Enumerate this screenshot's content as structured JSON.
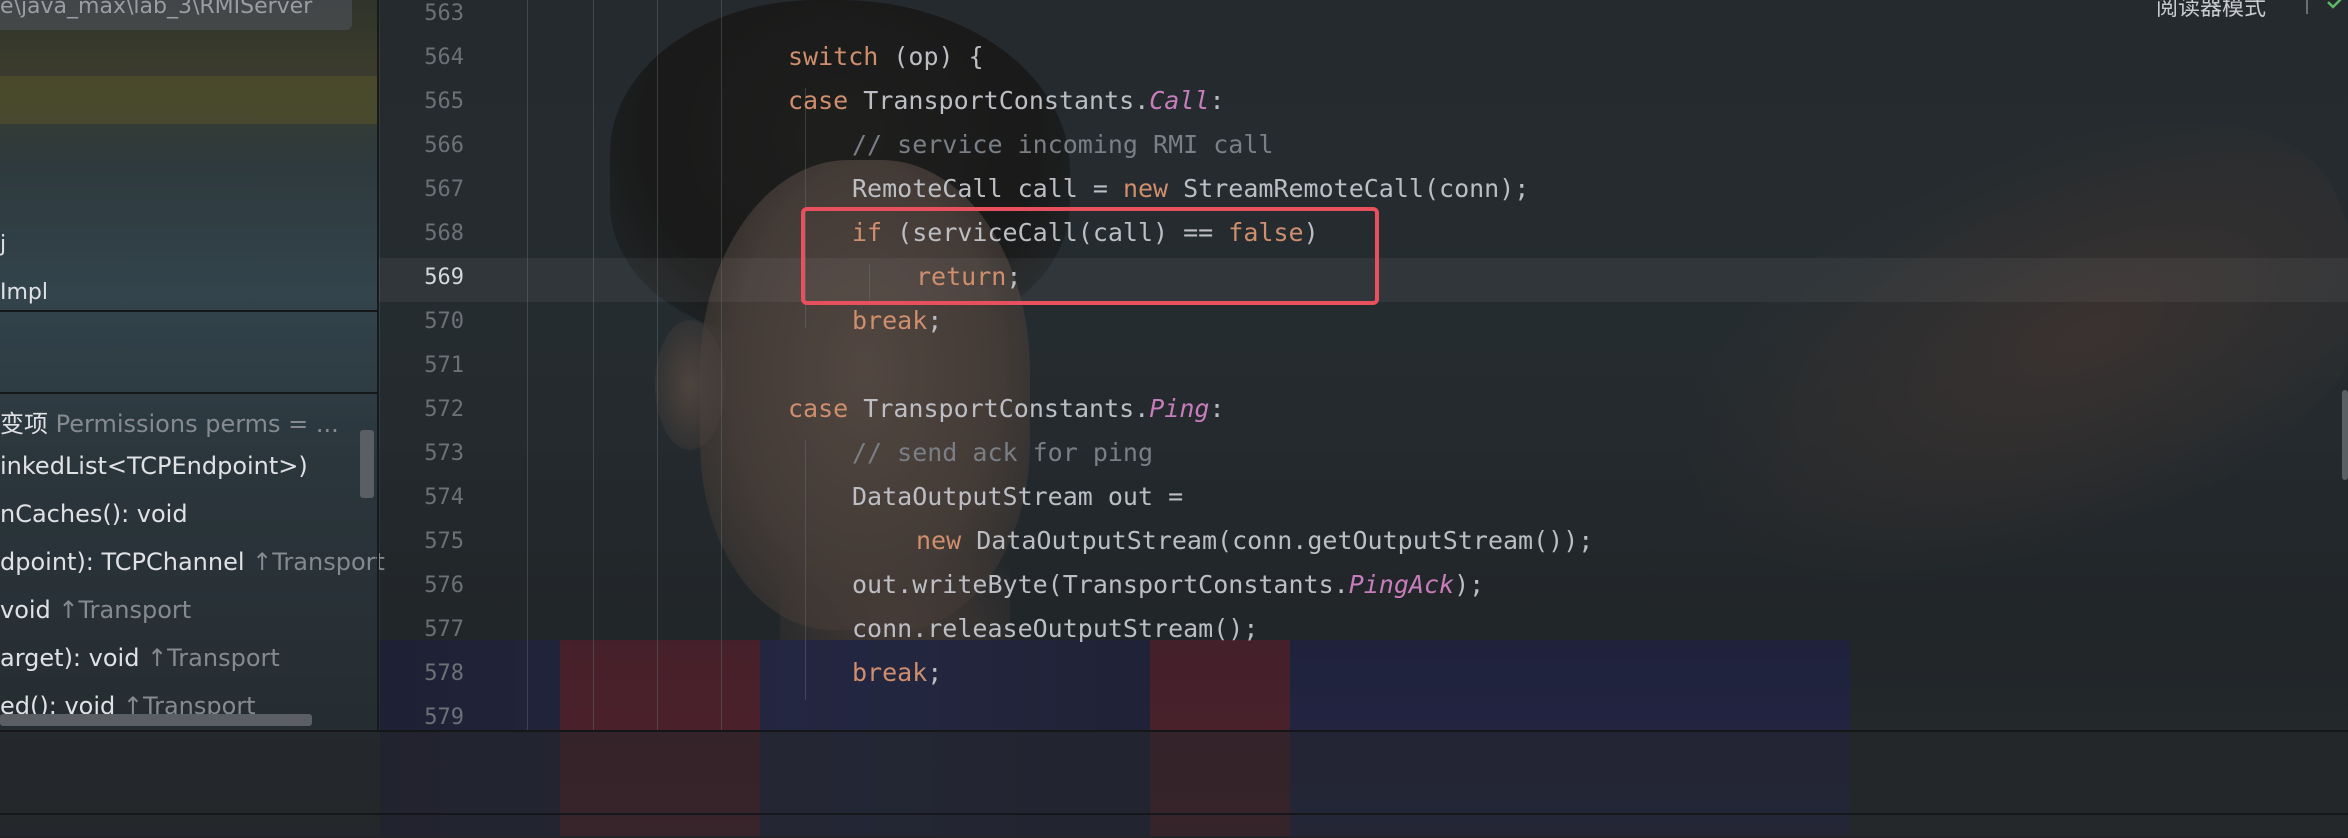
{
  "left_panel": {
    "path": "e\\java_max\\lab_3\\RMIServer",
    "project_items": [
      "j",
      "Impl"
    ],
    "structure_items": [
      {
        "main": "变项",
        "gray": " Permissions perms = ..."
      },
      {
        "main": "inkedList<TCPEndpoint>)",
        "gray": ""
      },
      {
        "main": "nCaches(): void",
        "gray": ""
      },
      {
        "main": "dpoint): TCPChannel",
        "gray": " ↑Transport"
      },
      {
        "main": "void",
        "gray": " ↑Transport"
      },
      {
        "main": "arget): void",
        "gray": " ↑Transport"
      },
      {
        "main": "ed(): void",
        "gray": " ↑Transport"
      }
    ]
  },
  "editor": {
    "reader_mode": "阅读器模式",
    "current_line": 569,
    "line_numbers": [
      563,
      564,
      565,
      566,
      567,
      568,
      569,
      570,
      571,
      572,
      573,
      574,
      575,
      576,
      577,
      578,
      579
    ],
    "code": {
      "l564": {
        "a": "switch",
        "b": " (op) {"
      },
      "l565": {
        "a": "case",
        "b": " TransportConstants.",
        "c": "Call",
        "d": ":"
      },
      "l566": {
        "a": "// service incoming RMI call"
      },
      "l567": {
        "a": "RemoteCall call = ",
        "b": "new",
        "c": " StreamRemoteCall(conn);"
      },
      "l568": {
        "a": "if",
        "b": " (serviceCall(call) == ",
        "c": "false",
        "d": ")"
      },
      "l569": {
        "a": "return",
        "b": ";"
      },
      "l570": {
        "a": "break",
        "b": ";"
      },
      "l572": {
        "a": "case",
        "b": " TransportConstants.",
        "c": "Ping",
        "d": ":"
      },
      "l573": {
        "a": "// send ack for ping"
      },
      "l574": {
        "a": "DataOutputStream out ="
      },
      "l575": {
        "a": "new",
        "b": " DataOutputStream(conn.getOutputStream());"
      },
      "l576": {
        "a": "out.writeByte(TransportConstants.",
        "b": "PingAck",
        "c": ");"
      },
      "l577": {
        "a": "conn.releaseOutputStream();"
      },
      "l578": {
        "a": "break",
        "b": ";"
      }
    }
  },
  "colors": {
    "keyword": "#cf8e6d",
    "constant": "#c77dbb",
    "comment": "#7a7e85",
    "text": "#bcbec4",
    "highlight_box": "#e8505e"
  }
}
